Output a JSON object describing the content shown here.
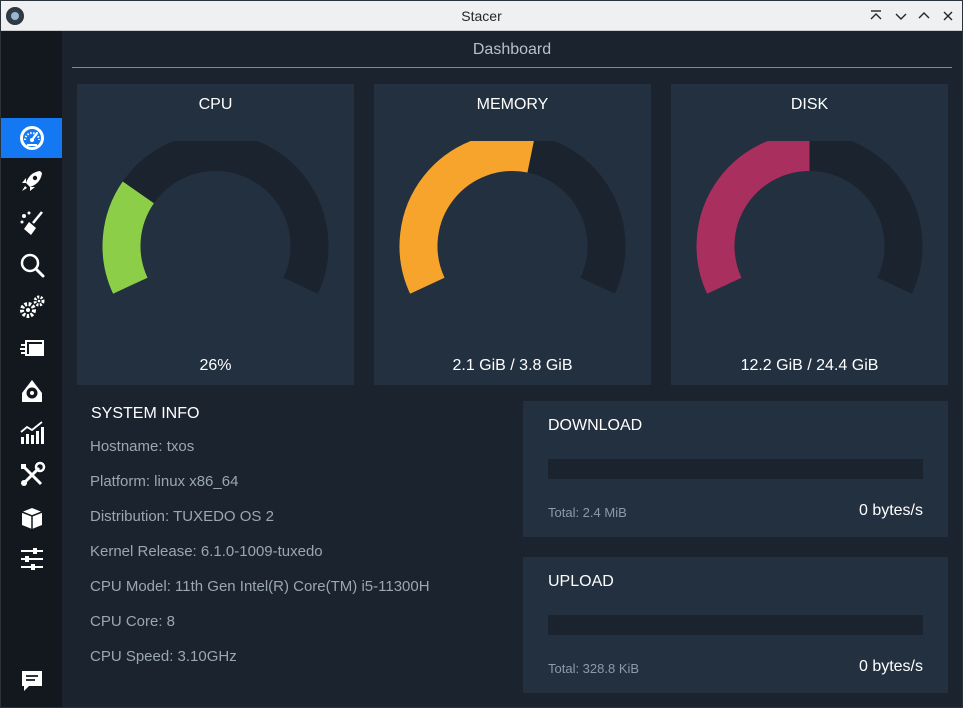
{
  "window": {
    "title": "Stacer",
    "controls": [
      "keep-above-icon",
      "minimize-icon",
      "maximize-icon",
      "close-icon"
    ]
  },
  "sidebar": {
    "items": [
      {
        "name": "dashboard",
        "icon": "dashboard-gauge-icon",
        "active": true
      },
      {
        "name": "startup-apps",
        "icon": "rocket-icon",
        "active": false
      },
      {
        "name": "system-cleaner",
        "icon": "broom-icon",
        "active": false
      },
      {
        "name": "search",
        "icon": "magnifier-icon",
        "active": false
      },
      {
        "name": "services",
        "icon": "gears-icon",
        "active": false
      },
      {
        "name": "processes",
        "icon": "processes-icon",
        "active": false
      },
      {
        "name": "uninstaller",
        "icon": "disk-uninstall-icon",
        "active": false
      },
      {
        "name": "resources",
        "icon": "chart-icon",
        "active": false
      },
      {
        "name": "helpers",
        "icon": "tools-icon",
        "active": false
      },
      {
        "name": "apt-repository",
        "icon": "package-box-icon",
        "active": false
      },
      {
        "name": "gnome-settings",
        "icon": "sliders-icon",
        "active": false
      }
    ],
    "feedback": {
      "icon": "feedback-message-icon"
    }
  },
  "page": {
    "title": "Dashboard"
  },
  "gauges": [
    {
      "title": "CPU",
      "value_text": "26%",
      "fraction": 0.26,
      "color": "#8cce48"
    },
    {
      "title": "MEMORY",
      "value_text": "2.1 GiB / 3.8 GiB",
      "fraction": 0.55,
      "color": "#f7a42c"
    },
    {
      "title": "DISK",
      "value_text": "12.2 GiB / 24.4 GiB",
      "fraction": 0.5,
      "color": "#a9305e"
    }
  ],
  "gauge_track_color": "#1b242e",
  "system_info": {
    "title": "SYSTEM INFO",
    "lines": [
      "Hostname: txos",
      "Platform: linux x86_64",
      "Distribution: TUXEDO OS 2",
      "Kernel Release: 6.1.0-1009-tuxedo",
      "CPU Model: 11th Gen Intel(R) Core(TM) i5-11300H",
      "CPU Core: 8",
      "CPU Speed: 3.10GHz"
    ]
  },
  "network": {
    "download": {
      "title": "DOWNLOAD",
      "total": "Total: 2.4 MiB",
      "speed": "0 bytes/s",
      "fraction": 0
    },
    "upload": {
      "title": "UPLOAD",
      "total": "Total: 328.8 KiB",
      "speed": "0 bytes/s",
      "fraction": 0
    }
  },
  "colors": {
    "accent": "#1478f2",
    "card": "#223040",
    "background": "#1b242e",
    "sidebar": "#12181e"
  }
}
